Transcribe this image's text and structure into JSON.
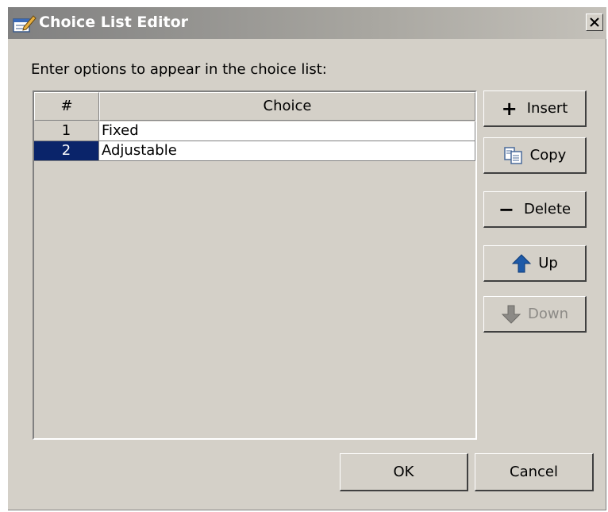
{
  "window": {
    "title": "Choice List Editor"
  },
  "prompt": "Enter options to appear in the choice list:",
  "table": {
    "columns": [
      "#",
      "Choice"
    ],
    "rows": [
      {
        "num": "1",
        "choice": "Fixed",
        "selected": false
      },
      {
        "num": "2",
        "choice": "Adjustable",
        "selected": true
      }
    ]
  },
  "buttons": {
    "insert": "Insert",
    "insert_symbol": "+",
    "copy": "Copy",
    "delete": "Delete",
    "delete_symbol": "−",
    "up": "Up",
    "down": "Down",
    "ok": "OK",
    "cancel": "Cancel"
  },
  "colors": {
    "selection": "#0a246a",
    "dialog_bg": "#d4d0c8",
    "arrow_blue": "#1e5aa8",
    "disabled": "#8c8a86"
  }
}
